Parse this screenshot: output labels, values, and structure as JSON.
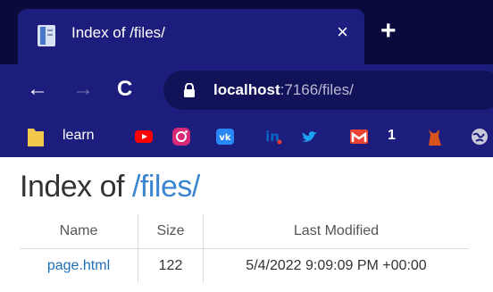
{
  "browser": {
    "tab": {
      "title": "Index of /files/",
      "close": "×"
    },
    "new_tab": "+",
    "nav": {
      "back": "←",
      "forward": "→",
      "reload": "C"
    },
    "address": {
      "host": "localhost",
      "rest": ":7166/files/"
    },
    "bookmarks": [
      {
        "name": "learn",
        "icon": "folder-icon",
        "color": "#f2c94c"
      },
      {
        "icon": "youtube-icon",
        "color": "#ff0000"
      },
      {
        "icon": "instagram-icon",
        "color": "#d62976"
      },
      {
        "icon": "vk-icon",
        "color": "#2787f5"
      },
      {
        "icon": "linkedin-icon",
        "color": "#0a66c2"
      },
      {
        "icon": "twitter-icon",
        "color": "#1da1f2"
      },
      {
        "name": "1",
        "icon": "gmail-icon",
        "color": "#ea4335"
      },
      {
        "icon": "cat-icon",
        "color": "#d9531e"
      },
      {
        "icon": "globe-icon",
        "color": "#c9c9d9"
      }
    ]
  },
  "page": {
    "heading_prefix": "Index of",
    "heading_path": "/files/",
    "table": {
      "headers": {
        "name": "Name",
        "size": "Size",
        "modified": "Last Modified"
      },
      "rows": [
        {
          "name": "page.html",
          "size": "122",
          "modified": "5/4/2022 9:09:09 PM +00:00"
        }
      ]
    }
  }
}
